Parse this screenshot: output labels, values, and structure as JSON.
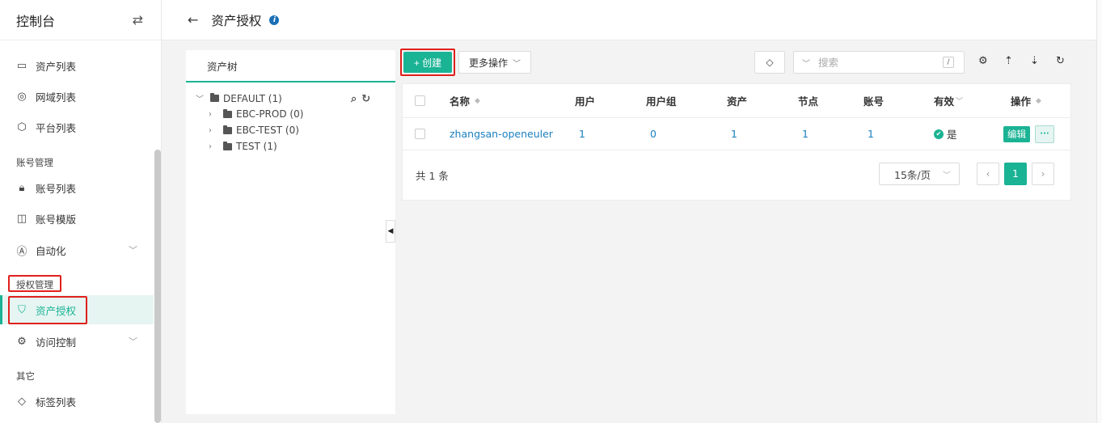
{
  "sidebar": {
    "title": "控制台",
    "items": [
      {
        "label": "资产列表",
        "icon": "monitor-icon"
      },
      {
        "label": "网域列表",
        "icon": "location-pin-icon"
      },
      {
        "label": "平台列表",
        "icon": "cube-icon"
      },
      {
        "label": "账号列表",
        "icon": "lock-icon"
      },
      {
        "label": "账号模版",
        "icon": "layout-template-icon"
      },
      {
        "label": "自动化",
        "icon": "automation-icon"
      },
      {
        "label": "资产授权",
        "icon": "shield-icon"
      },
      {
        "label": "访问控制",
        "icon": "access-control-icon"
      },
      {
        "label": "标签列表",
        "icon": "tag-icon"
      }
    ],
    "sections": {
      "account": "账号管理",
      "perm": "授权管理",
      "other": "其它"
    }
  },
  "header": {
    "title": "资产授权"
  },
  "tree": {
    "tab_label": "资产树",
    "root": "DEFAULT (1)",
    "children": [
      "EBC-PROD (0)",
      "EBC-TEST (0)",
      "TEST (1)"
    ]
  },
  "toolbar": {
    "create_label": "+ 创建",
    "more_label": "更多操作",
    "search_placeholder": "搜索",
    "search_shortcut": "/"
  },
  "table": {
    "columns": [
      "名称",
      "用户",
      "用户组",
      "资产",
      "节点",
      "账号",
      "有效",
      "操作"
    ],
    "rows": [
      {
        "name": "zhangsan-openeuler",
        "users": "1",
        "user_groups": "0",
        "assets": "1",
        "nodes": "1",
        "accounts": "1",
        "valid": "是",
        "edit_label": "编辑",
        "more_label": "···"
      }
    ],
    "total": "共 1 条",
    "page_size": "15条/页",
    "current_page": "1"
  },
  "colors": {
    "accent": "#1ab394",
    "link": "#1a7fbf",
    "highlight": "#e0201c"
  }
}
